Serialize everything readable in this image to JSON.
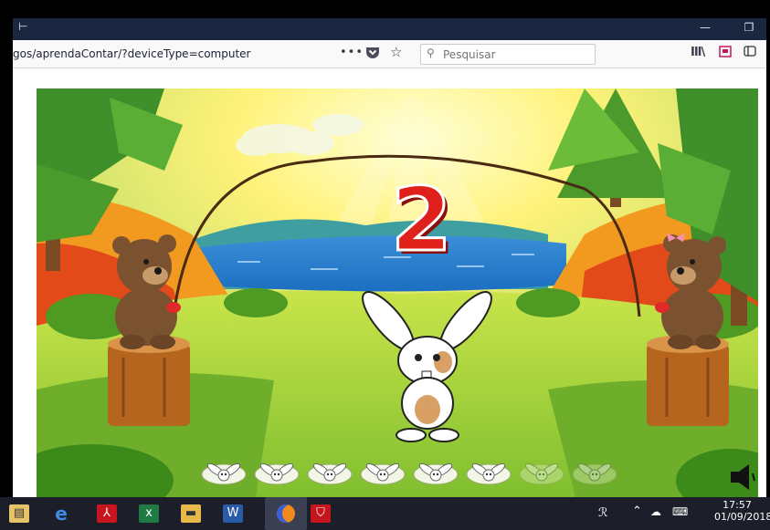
{
  "browser": {
    "url": "gos/aprendaContar/?deviceType=computer",
    "search_placeholder": "Pesquisar",
    "page_actions": "•••",
    "titlebar_left": "⊢",
    "minimize": "—",
    "restore": "❐"
  },
  "game": {
    "count_number": "2",
    "total_bunnies": 8,
    "filled_bunnies": 6,
    "colors": {
      "number_red": "#e0201b",
      "number_outline": "#ffffff",
      "grass": "#8cc63f",
      "sky": "#e8f4a8"
    }
  },
  "taskbar": {
    "time": "17:57",
    "date": "01/09/2018",
    "icons": [
      "file-explorer-icon",
      "edge-icon",
      "acrobat-icon",
      "excel-icon",
      "folder-icon",
      "word-icon",
      "firefox-icon",
      "mcafee-icon"
    ]
  }
}
